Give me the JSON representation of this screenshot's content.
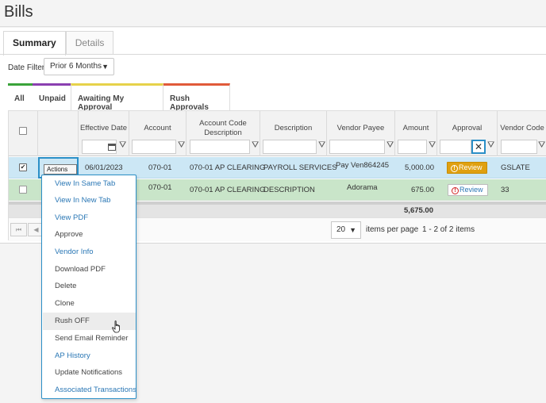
{
  "page": {
    "title": "Bills"
  },
  "tabs": [
    {
      "label": "Summary",
      "active": true
    },
    {
      "label": "Details",
      "active": false
    }
  ],
  "date_filter": {
    "label": "Date Filter",
    "value": "Prior 6 Months"
  },
  "sub_tabs": [
    {
      "label": "All",
      "color": "#3aa33a"
    },
    {
      "label": "Unpaid",
      "color": "#8a3fb0"
    },
    {
      "label": "Awaiting My Approval",
      "color": "#e6d24a",
      "active": true
    },
    {
      "label": "Rush Approvals",
      "color": "#e05a3a"
    }
  ],
  "grid": {
    "columns": {
      "effective_date": "Effective Date",
      "account": "Account",
      "account_code_description": "Account Code Description",
      "description": "Description",
      "vendor_payee": "Vendor Payee",
      "amount": "Amount",
      "approval": "Approval",
      "vendor_code": "Vendor Code"
    },
    "rows": [
      {
        "checked": "✔",
        "actions_label": "Actions ▼",
        "effective_date": "06/01/2023",
        "account": "070-01",
        "account_code_description": "070-01 AP CLEARING",
        "description": "PAYROLL SERVICES",
        "vendor_payee": "Pay Ven864245",
        "amount": "5,000.00",
        "approval": "Review",
        "vendor_code": "GSLATE"
      },
      {
        "checked": "",
        "actions_label": "",
        "effective_date": "",
        "account": "070-01",
        "account_code_description": "070-01 AP CLEARING",
        "description": "DESCRIPTION",
        "vendor_payee": "Adorama",
        "amount": "675.00",
        "approval": "Review",
        "vendor_code": "33"
      }
    ],
    "total_amount": "5,675.00"
  },
  "pager": {
    "page_size": "20",
    "items_per_page_label": "items per page",
    "range": "1 - 2 of 2 items"
  },
  "actions_menu": {
    "items": [
      {
        "label": "View In Same Tab",
        "style": "link"
      },
      {
        "label": "View In New Tab",
        "style": "link"
      },
      {
        "label": "View PDF",
        "style": "link"
      },
      {
        "label": "Approve",
        "style": "plain"
      },
      {
        "label": "Vendor Info",
        "style": "link"
      },
      {
        "label": "Download PDF",
        "style": "plain"
      },
      {
        "label": "Delete",
        "style": "plain"
      },
      {
        "label": "Clone",
        "style": "plain"
      },
      {
        "label": "Rush OFF",
        "style": "plain",
        "hovered": true
      },
      {
        "label": "Send Email Reminder",
        "style": "plain"
      },
      {
        "label": "AP History",
        "style": "link"
      },
      {
        "label": "Update Notifications",
        "style": "plain"
      },
      {
        "label": "Associated Transactions",
        "style": "link"
      }
    ]
  },
  "colors": {
    "selected_row": "#cce7f5",
    "approved_row": "#c9e5c9",
    "review_orange": "#e0a010",
    "link_blue": "#2a77b5",
    "focus_blue": "#2b8fc7"
  }
}
